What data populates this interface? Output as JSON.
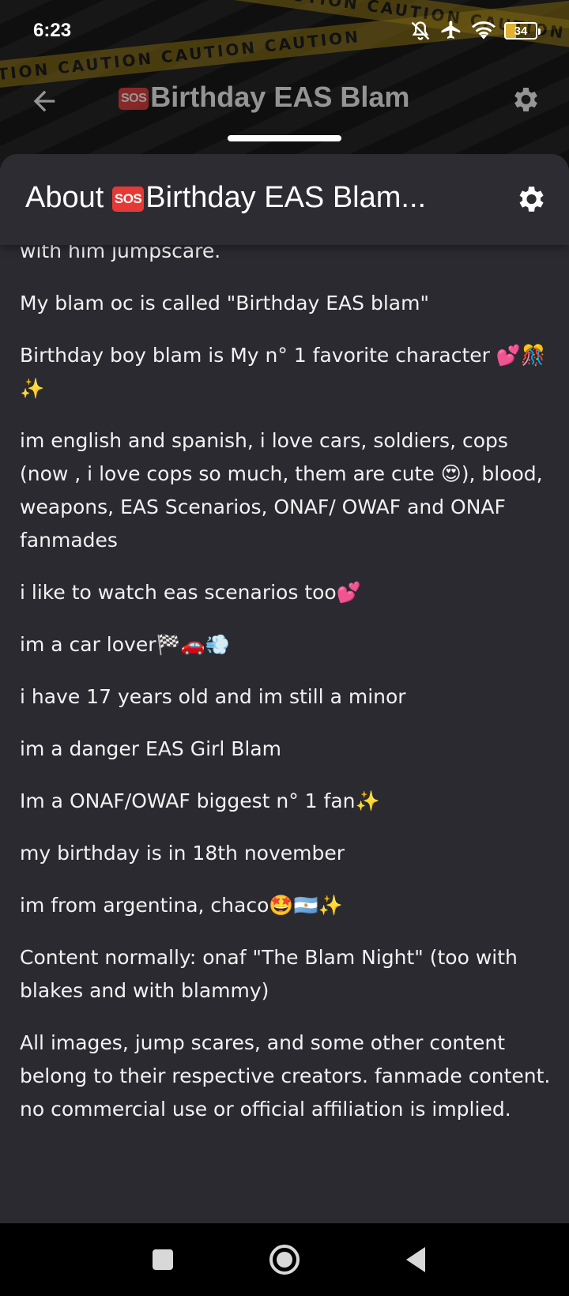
{
  "status_bar": {
    "time": "6:23",
    "battery_level": "34",
    "icons": [
      "bell-off-icon",
      "airplane-icon",
      "wifi-icon",
      "battery-icon"
    ]
  },
  "background_app_bar": {
    "title": "Birthday EAS Blam",
    "title_badge": "SOS",
    "tape_text": "CAUTION   CAUTION   CAUTION   CAUTION"
  },
  "sheet": {
    "title": "About ",
    "title_badge": "SOS",
    "title_rest": "Birthday EAS Blam..."
  },
  "about": {
    "paragraphs": [
      "with him jumpscare.",
      "My blam oc is called \"Birthday EAS blam\"",
      "Birthday boy blam is My n° 1 favorite character 💕🎊✨",
      "im english and spanish, i love cars, soldiers, cops (now , i love cops so much, them are cute 😍), blood, weapons, EAS Scenarios, ONAF/ OWAF and ONAF fanmades",
      "i like to watch eas scenarios too💕",
      "im a car lover🏁🚗💨",
      "i have 17 years old and im still a minor",
      "im a danger EAS Girl Blam",
      "Im a ONAF/OWAF biggest n° 1 fan✨",
      "my birthday is in 18th november",
      "im from argentina, chaco🤩🇦🇷✨",
      "Content normally: onaf \"The Blam Night\" (too with blakes and with blammy)",
      "All images, jump scares, and some other content belong to their respective creators. fanmade content. no commercial use or official affiliation is implied."
    ]
  },
  "colors": {
    "sheet_background": "#2a2a30",
    "sos_badge": "#e53935",
    "text": "#f2f2f2"
  }
}
